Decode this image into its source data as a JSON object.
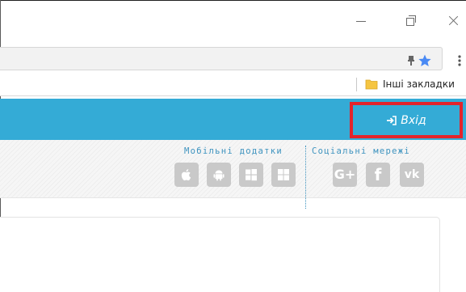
{
  "window": {
    "controls": [
      {
        "name": "minimize",
        "icon": "minimize-icon"
      },
      {
        "name": "restore",
        "icon": "restore-icon"
      },
      {
        "name": "close",
        "icon": "close-icon"
      }
    ]
  },
  "toolbar": {
    "icons": [
      "extension-icon",
      "bookmark-star-icon",
      "menu-kebab-icon"
    ],
    "star_color": "#4a8af4"
  },
  "bookmarks": {
    "other_bookmarks_label": "Інші закладки",
    "folder_icon": "folder-icon",
    "folder_color": "#f5c542"
  },
  "header": {
    "login_label": "Вхід",
    "login_icon": "sign-in-icon",
    "background_color": "#34abd6",
    "highlight_color": "#e3242b"
  },
  "apps": {
    "mobile_label": "Мобільні додатки",
    "social_label": "Соціальні мережі",
    "mobile_tiles": [
      "apple-icon",
      "android-icon",
      "windows-icon",
      "windows-phone-icon"
    ],
    "social_tiles": [
      {
        "icon": "google-plus-icon",
        "text": "G+"
      },
      {
        "icon": "facebook-icon",
        "text": "f"
      },
      {
        "icon": "vk-icon",
        "text": "vk"
      }
    ],
    "accent_color": "#3d93bf"
  }
}
